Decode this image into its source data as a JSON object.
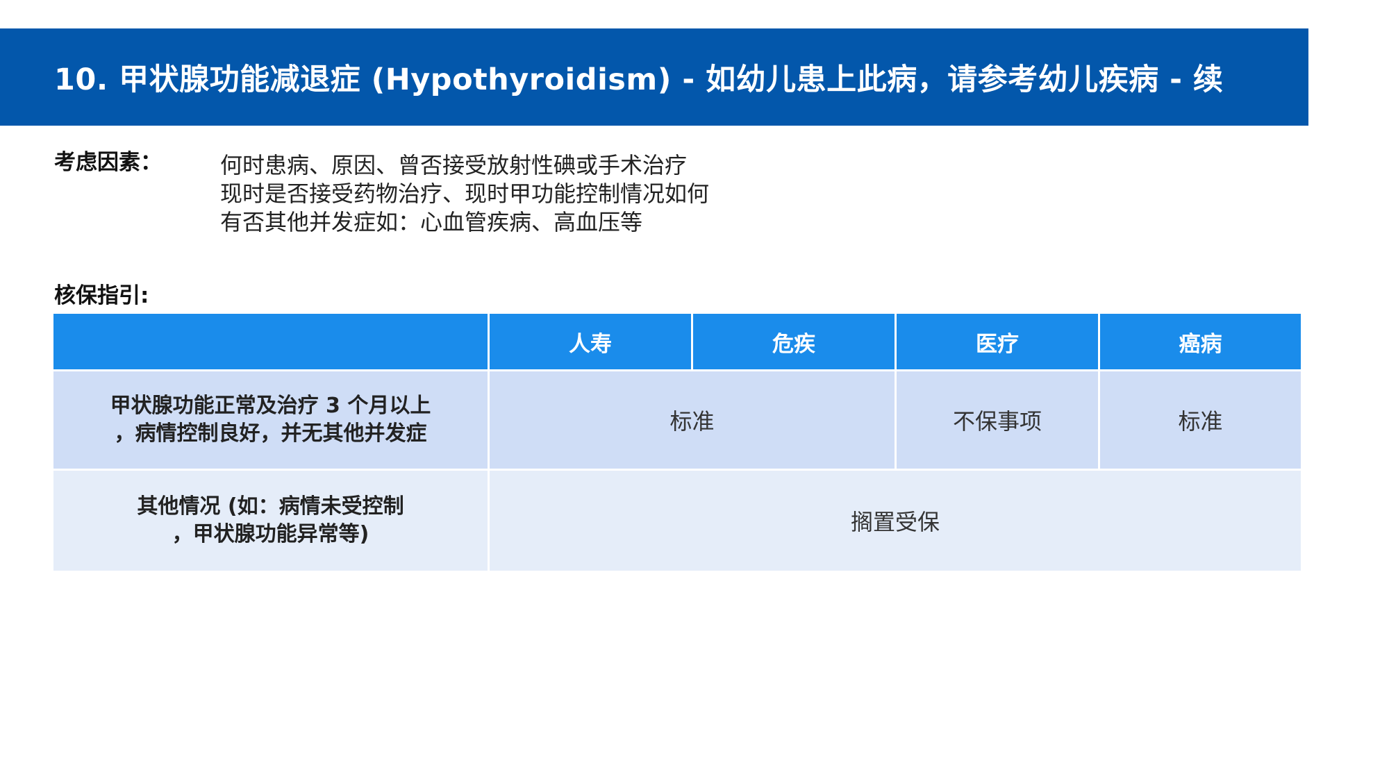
{
  "title": "10. 甲状腺功能减退症 (Hypothyroidism)  - 如幼儿患上此病，请参考幼儿疾病 - 续",
  "factors": {
    "label": "考虑因素：",
    "items": [
      "何时患病、原因、曾否接受放射性碘或手术治疗",
      "现时是否接受药物治疗、现时甲功能控制情况如何",
      "有否其他并发症如：心血管疾病、高血压等"
    ]
  },
  "guide": {
    "label": "核保指引:"
  },
  "table": {
    "headers": [
      "",
      "人寿",
      "危疾",
      "医疗",
      "癌病"
    ],
    "rows": [
      {
        "label_lines": [
          "甲状腺功能正常及治疗 3 个月以上",
          "，病情控制良好，并无其他并发症"
        ],
        "life_critical": "标准",
        "medical": "不保事项",
        "cancer": "标准"
      },
      {
        "label_lines": [
          "其他情况 (如：病情未受控制",
          "，甲状腺功能异常等)"
        ],
        "all": "搁置受保"
      }
    ]
  },
  "colors": {
    "title_bar": "#0357ab",
    "table_header": "#1a8ceb",
    "row1": "#cfddf6",
    "row2": "#e5edf9"
  }
}
